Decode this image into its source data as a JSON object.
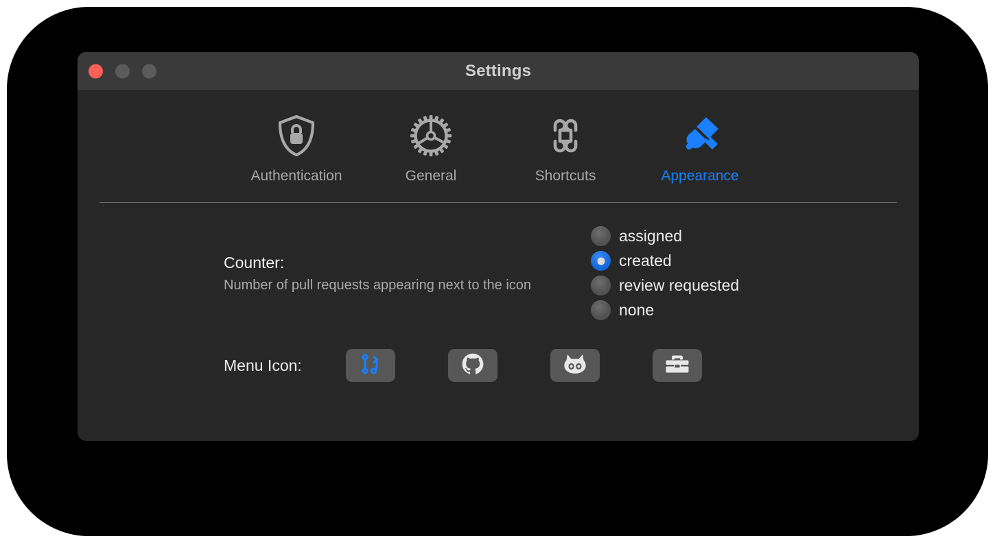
{
  "window": {
    "title": "Settings",
    "traffic_lights": [
      {
        "name": "close",
        "color": "#fe5f57",
        "state": "active"
      },
      {
        "name": "minimize",
        "color": "#5b5b5b",
        "state": "inactive"
      },
      {
        "name": "zoom",
        "color": "#5b5b5b",
        "state": "inactive"
      }
    ]
  },
  "toolbar": {
    "tabs": [
      {
        "label": "Authentication",
        "icon": "shield-lock-icon",
        "active": false
      },
      {
        "label": "General",
        "icon": "gear-icon",
        "active": false
      },
      {
        "label": "Shortcuts",
        "icon": "command-key-icon",
        "active": false
      },
      {
        "label": "Appearance",
        "icon": "paintbrush-icon",
        "active": true
      }
    ],
    "active_tab": "Appearance",
    "accent_color": "#1a80ff"
  },
  "counter": {
    "title": "Counter:",
    "subtitle": "Number of pull requests appearing next to the icon",
    "options": [
      {
        "label": "assigned",
        "selected": false
      },
      {
        "label": "created",
        "selected": true
      },
      {
        "label": "review requested",
        "selected": false
      },
      {
        "label": "none",
        "selected": false
      }
    ],
    "selected_value": "created"
  },
  "menu_icon": {
    "label": "Menu Icon:",
    "choices": [
      {
        "icon": "git-pull-request-icon",
        "selected": true
      },
      {
        "icon": "github-octocat-logo-icon",
        "selected": false
      },
      {
        "icon": "octocat-face-icon",
        "selected": false
      },
      {
        "icon": "toolbox-icon",
        "selected": false
      }
    ],
    "selected_index": 0,
    "selected_color": "#1a80ff",
    "unselected_color": "#e8e8e8"
  }
}
